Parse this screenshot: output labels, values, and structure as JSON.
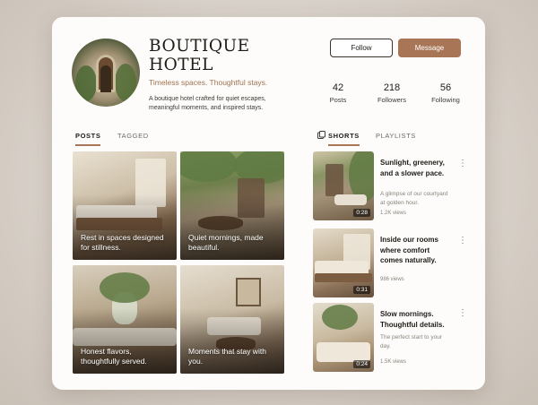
{
  "profile": {
    "name_line1": "BOUTIQUE",
    "name_line2": "HOTEL",
    "tagline": "Timeless spaces. Thoughtful stays.",
    "bio": "A boutique hotel crafted for quiet escapes, meaningful moments, and inspired stays."
  },
  "actions": {
    "follow_label": "Follow",
    "message_label": "Message"
  },
  "stats": [
    {
      "value": "42",
      "label": "Posts"
    },
    {
      "value": "218",
      "label": "Followers"
    },
    {
      "value": "56",
      "label": "Following"
    }
  ],
  "left_tabs": [
    {
      "label": "POSTS",
      "active": true
    },
    {
      "label": "TAGGED",
      "active": false
    }
  ],
  "right_tabs": [
    {
      "label": "SHORTS",
      "active": true
    },
    {
      "label": "PLAYLISTS",
      "active": false
    }
  ],
  "posts": [
    {
      "caption": "Rest in spaces designed for stillness."
    },
    {
      "caption": "Quiet mornings, made beautiful."
    },
    {
      "caption": "Honest flavors, thoughtfully served."
    },
    {
      "caption": "Moments that stay with you."
    }
  ],
  "shorts": [
    {
      "title": "Sunlight, greenery, and a slower pace.",
      "subtitle": "A glimpse of our courtyard at golden hour.",
      "views": "1.2K views",
      "duration": "0:28"
    },
    {
      "title": "Inside our rooms where comfort comes naturally.",
      "subtitle": "",
      "views": "986 views",
      "duration": "0:31"
    },
    {
      "title": "Slow mornings. Thoughtful details.",
      "subtitle": "The perfect start to your day.",
      "views": "1.5K views",
      "duration": "0:24"
    }
  ],
  "icons": {
    "shorts_tab": "shorts-icon",
    "more": "more-vertical-icon"
  },
  "colors": {
    "accent": "#a87556",
    "tagline": "#a0724f"
  }
}
